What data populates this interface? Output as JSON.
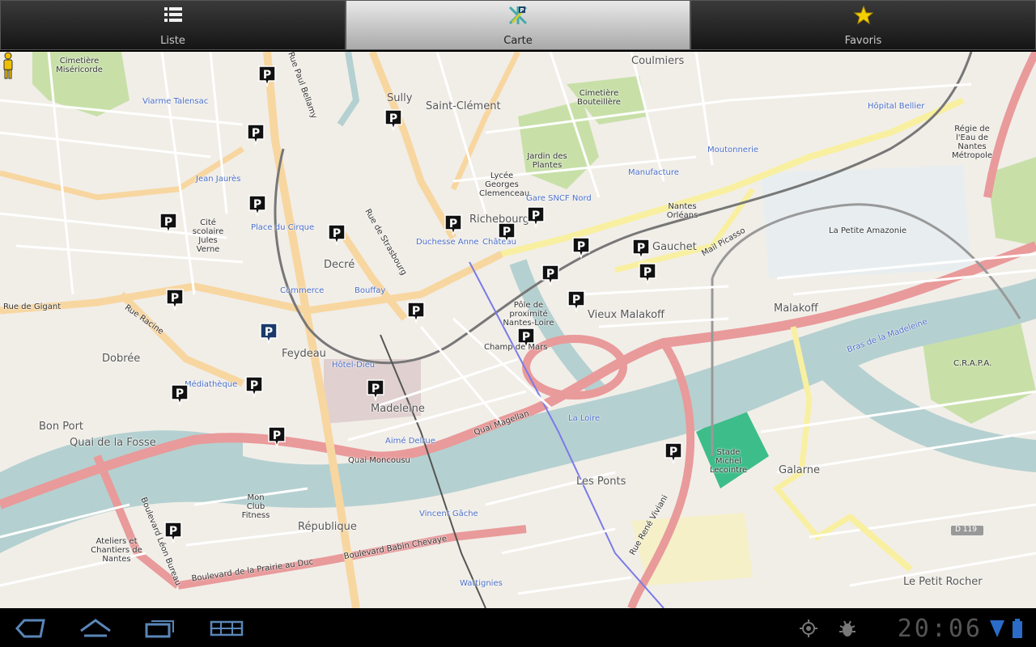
{
  "tabs": [
    {
      "label": "Liste",
      "icon": "list-icon"
    },
    {
      "label": "Carte",
      "icon": "map-icon"
    },
    {
      "label": "Favoris",
      "icon": "star-icon"
    }
  ],
  "map": {
    "places_large": [
      "Coulmiers",
      "Sully",
      "Saint-Clément",
      "Richebourg",
      "Gauchet",
      "Decré",
      "Feydeau",
      "Dobrée",
      "Bon Port",
      "Quai de la Fosse",
      "Madeleine",
      "République",
      "Les Ponts",
      "Vieux Malakoff",
      "Malakoff",
      "Galarne",
      "Le Petit Rocher"
    ],
    "places_small": [
      "Cimetière Miséricorde",
      "Cimetière Bouteillère",
      "Jardin des Plantes",
      "Lycée Georges Clemenceau",
      "Nantes Orléans",
      "Pôle de proximité Nantes-Loire",
      "Régie de l'Eau de Nantes Métropole",
      "La Petite Amazonie",
      "C.R.A.P.A.",
      "Stade Michel Lecointre",
      "Cité scolaire Jules Verne",
      "Mon Club Fitness",
      "Ateliers et Chantiers de Nantes",
      "Champ de Mars"
    ],
    "stations": [
      "Viarme Talensac",
      "Jean Jaurès",
      "Place du Cirque",
      "Commerce",
      "Bouffay",
      "Duchesse Anne",
      "Château",
      "Gare SNCF Nord",
      "Manufacture",
      "Moutonnerie",
      "Hôpital Bellier",
      "Médiathèque",
      "Hôtel-Dieu",
      "Aimé Delrue",
      "Vincent Gâche",
      "Wattignies"
    ],
    "streets": [
      "Rue Paul Bellamy",
      "Rue de Strasbourg",
      "Rue Racine",
      "Boulevard de la Prairie au Duc",
      "Boulevard Babin Chevaye",
      "Boulevard Léon Bureau",
      "Rue René Viviani",
      "Quai Magellan",
      "Quai Moncousu",
      "Rue de Gigant",
      "Mail Picasso",
      "Bras de la Madeleine",
      "La Loire",
      "D 119"
    ]
  },
  "status": {
    "time": "20:06"
  },
  "colors": {
    "water": "#b5d0d0",
    "primary_road": "#e99a9a",
    "secondary_road": "#f8d6a0",
    "park": "#c8e0a8"
  }
}
